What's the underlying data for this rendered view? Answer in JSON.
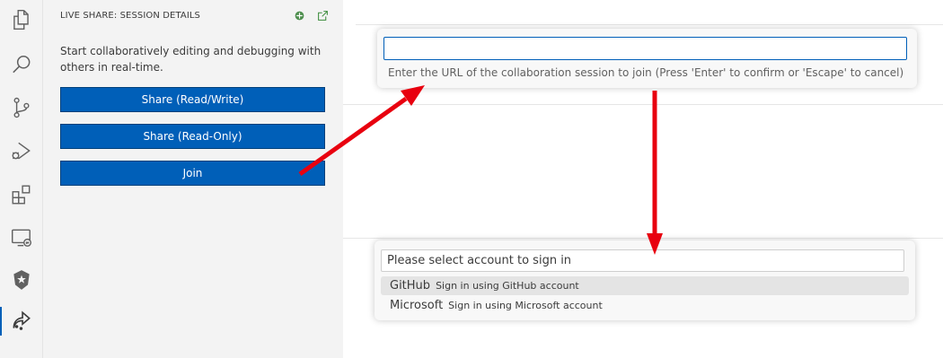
{
  "sidebar": {
    "header_title": "LIVE SHARE: SESSION DETAILS",
    "header_actions": [
      "live-share-icon",
      "open-external-icon"
    ],
    "intro": "Start collaboratively editing and debugging with others in real-time.",
    "buttons": {
      "share_rw": "Share (Read/Write)",
      "share_ro": "Share (Read-Only)",
      "join": "Join"
    },
    "accent_color": "#005fb8"
  },
  "activity_bar": {
    "items": [
      "explorer-icon",
      "search-icon",
      "source-control-icon",
      "run-debug-icon",
      "extensions-icon",
      "remote-explorer-icon",
      "shield-icon",
      "live-share-icon"
    ],
    "active": "live-share-icon"
  },
  "url_prompt": {
    "value": "",
    "hint": "Enter the URL of the collaboration session to join (Press 'Enter' to confirm or 'Escape' to cancel)"
  },
  "account_prompt": {
    "placeholder": "Please select account to sign in",
    "items": [
      {
        "name": "GitHub",
        "description": "Sign in using GitHub account",
        "selected": true
      },
      {
        "name": "Microsoft",
        "description": "Sign in using Microsoft account",
        "selected": false
      }
    ]
  },
  "annotation": {
    "arrow_color": "#e8000f"
  }
}
